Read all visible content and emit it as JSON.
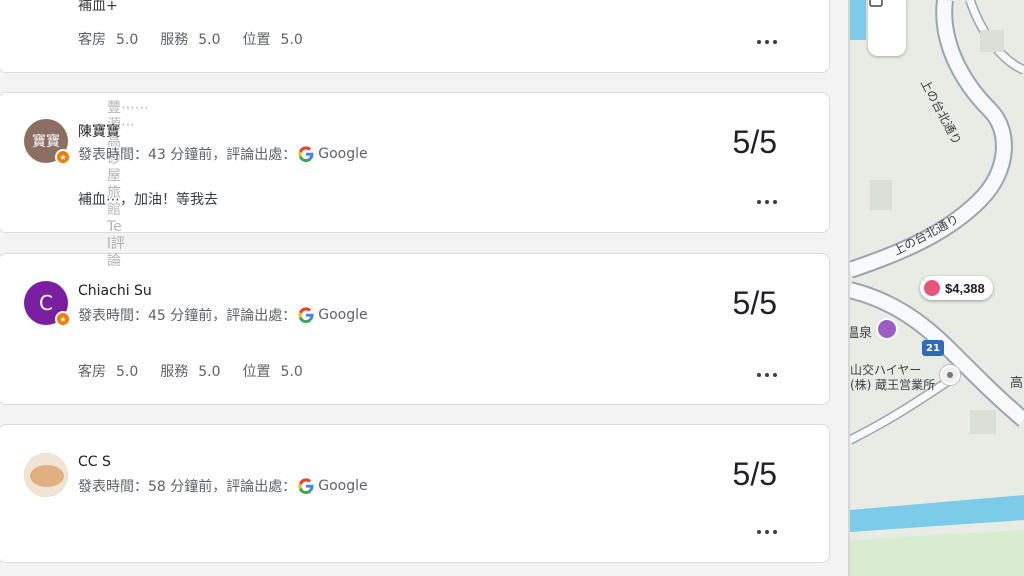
{
  "reviews": [
    {
      "text": "補血+",
      "ratings": [
        {
          "label": "客房",
          "value": "5.0"
        },
        {
          "label": "服務",
          "value": "5.0"
        },
        {
          "label": "位置",
          "value": "5.0"
        }
      ]
    },
    {
      "avatar_text": "寶寶",
      "name": "陳寶寶",
      "meta": "發表時間：43 分鐘前，評論出處：",
      "source": "Google",
      "score": "5/5",
      "text": "補血⋯，加油！等我去"
    },
    {
      "avatar_text": "C",
      "name": "Chiachi Su",
      "meta": "發表時間：45 分鐘前，評論出處：",
      "source": "Google",
      "score": "5/5",
      "ratings": [
        {
          "label": "客房",
          "value": "5.0"
        },
        {
          "label": "服務",
          "value": "5.0"
        },
        {
          "label": "位置",
          "value": "5.0"
        }
      ]
    },
    {
      "name": "CC S",
      "meta": "發表時間：58 分鐘前，評論出處：",
      "source": "Google",
      "score": "5/5"
    }
  ],
  "overlay_text": "豐⋯⋯源⋯高砂屋旅館Tel評論",
  "map": {
    "price": "$4,388",
    "route_number": "21",
    "street_label_1": "上の台北通り",
    "street_label_2": "上の台北通り",
    "poi_label_1": "温泉",
    "poi_label_2": "山交ハイヤー",
    "poi_label_3": "(株) 蔵王営業所",
    "poi_label_4": "高"
  },
  "colors": {
    "card_bg": "#ffffff",
    "page_bg": "#f3f3f3",
    "meta_gray": "#5f6368",
    "map_road": "#9aa5b1",
    "map_water": "#6fc3e6"
  }
}
